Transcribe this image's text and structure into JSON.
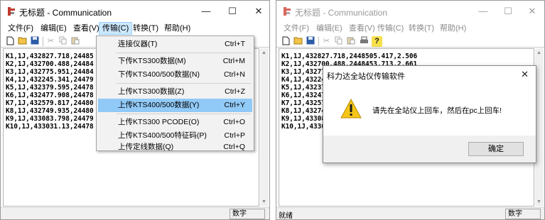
{
  "window": {
    "title": "无标题 - Communication",
    "minimize_glyph": "—",
    "maximize_glyph": "☐",
    "close_glyph": "✕"
  },
  "menu": [
    "文件(F)",
    "编辑(E)",
    "查看(V)",
    "传输(C)",
    "转换(T)",
    "帮助(H)"
  ],
  "toolbar_icons": [
    "new-file-icon",
    "open-folder-icon",
    "save-icon",
    "cut-icon",
    "copy-icon",
    "paste-icon",
    "print-icon",
    "help-icon"
  ],
  "left_lines": [
    "K1,1J,432827.718,24485",
    "K2,1J,432700.488,24484",
    "K3,1J,432775.951,24484",
    "K4,1J,432245.341,24479",
    "K5,1J,432379.595,24478",
    "K6,1J,432477.908,24478",
    "K7,1J,432579.817,24480",
    "K8,1J,432749.935,24480",
    "K9,1J,433083.798,24479",
    "K10,1J,433031.13,24478"
  ],
  "right_lines": [
    "K1,1J,432827.718,2448505.417,2.506",
    "K2,1J,432700.488,2448453.713,2.661",
    "K3,1J,432775.",
    "K4,1J,432245.",
    "K5,1J,432379.",
    "K6,1J,432477.",
    "K7,1J,432579.",
    "K8,1J,432749.",
    "K9,1J,433083.",
    "K10,1J,433031"
  ],
  "dropdown": [
    {
      "label": "连接仪器(T)",
      "shortcut": "Ctrl+T"
    },
    {
      "label": "下传KTS300数据(M)",
      "shortcut": "Ctrl+M"
    },
    {
      "label": "下传KTS400/500数据(N)",
      "shortcut": "Ctrl+N"
    },
    {
      "label": "上传KTS300数据(Z)",
      "shortcut": "Ctrl+Z"
    },
    {
      "label": "上传KTS400/500数据(Y)",
      "shortcut": "Ctrl+Y"
    },
    {
      "label": "上传KTS300 PCODE(O)",
      "shortcut": "Ctrl+O"
    },
    {
      "label": "上传KTS400/500特征码(P)",
      "shortcut": "Ctrl+P"
    },
    {
      "label": "上传定线数据(Q)",
      "shortcut": "Ctrl+Q"
    }
  ],
  "status": {
    "left_text": "就绪",
    "num_indicator": "数字"
  },
  "dialog": {
    "title": "科力达全站仪传输软件",
    "close_glyph": "✕",
    "message": "请先在全站仪上回车，然后在pc上回车!",
    "ok_label": "确定"
  },
  "colors": {
    "highlight": "#91c9f7",
    "menu_active": "#cce8ff",
    "warning": "#f5c518"
  }
}
